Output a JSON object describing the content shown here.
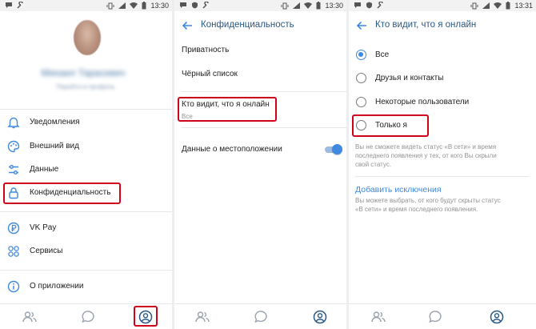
{
  "status_bar": {
    "time1": "13:30",
    "time2": "13:30",
    "time3": "13:31"
  },
  "colors": {
    "accent": "#3f8ae0",
    "header_title": "#2a5885",
    "highlight": "#d0021b",
    "secondary_text": "#939393"
  },
  "panel1": {
    "profile_name": "Михаил Тарасевич",
    "profile_sub": "Перейти в профиль",
    "menu": [
      {
        "label": "Уведомления",
        "icon": "bell-icon"
      },
      {
        "label": "Внешний вид",
        "icon": "palette-icon"
      },
      {
        "label": "Данные",
        "icon": "sliders-icon"
      },
      {
        "label": "Конфиденциальность",
        "icon": "lock-icon"
      },
      {
        "label": "VK Pay",
        "icon": "ruble-icon"
      },
      {
        "label": "Сервисы",
        "icon": "grid-icon"
      },
      {
        "label": "О приложении",
        "icon": "info-icon"
      }
    ]
  },
  "panel2": {
    "title": "Конфиденциальность",
    "items": [
      {
        "label": "Приватность"
      },
      {
        "label": "Чёрный список"
      },
      {
        "label": "Кто видит, что я онлайн",
        "sub": "Все"
      },
      {
        "label": "Данные о местоположении"
      }
    ],
    "location_toggle_on": true
  },
  "panel3": {
    "title": "Кто видит, что я онлайн",
    "options": [
      {
        "label": "Все",
        "checked": true
      },
      {
        "label": "Друзья и контакты",
        "checked": false
      },
      {
        "label": "Некоторые пользователи",
        "checked": false
      },
      {
        "label": "Только я",
        "checked": false
      }
    ],
    "note1_line1": "Вы не сможете видеть статус «В сети» и время",
    "note1_line2": "последнего появления у тех, от кого Вы скрыли",
    "note1_line3": "свой статус.",
    "exceptions_title": "Добавить исключения",
    "note2_line1": "Вы можете выбрать, от кого будут скрыты статус",
    "note2_line2": "«В сети» и время последнего появления."
  }
}
